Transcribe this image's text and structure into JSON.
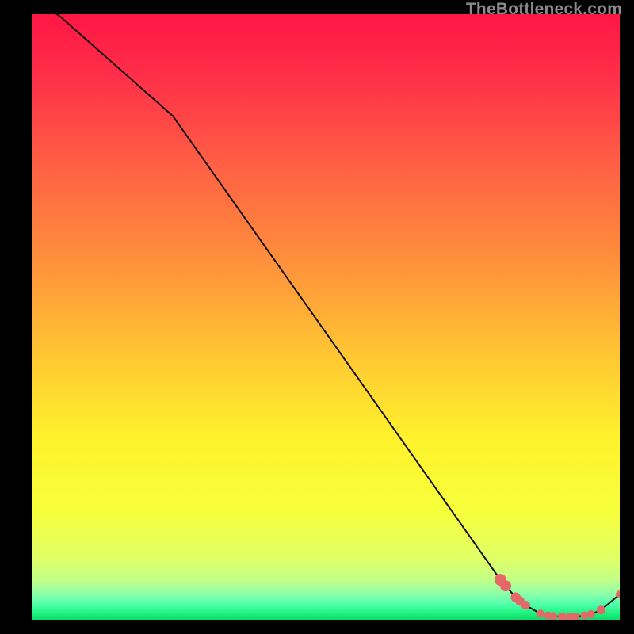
{
  "watermark": "TheBottleneck.com",
  "chart_data": {
    "type": "line",
    "title": "",
    "xlabel": "",
    "ylabel": "",
    "xlim": [
      0,
      100
    ],
    "ylim": [
      0,
      100
    ],
    "series": [
      {
        "name": "curve",
        "x": [
          0,
          5,
          24,
          79.7,
          80.6,
          82.3,
          83.0,
          84.0,
          86.5,
          87.8,
          88.7,
          90.1,
          90.3,
          91.5,
          92.5,
          94.0,
          95.1,
          96.8,
          100
        ],
        "values": [
          103,
          99.5,
          83.2,
          6.6,
          5.6,
          3.7,
          3.1,
          2.4,
          1.0,
          0.7,
          0.6,
          0.5,
          0.5,
          0.5,
          0.5,
          0.7,
          0.9,
          1.6,
          4.2
        ],
        "color": "#111111"
      },
      {
        "name": "markers",
        "x": [
          79.7,
          80.6,
          82.3,
          83.0,
          84.0,
          86.5,
          87.8,
          88.7,
          90.1,
          90.3,
          91.5,
          92.5,
          94.0,
          95.1,
          96.8,
          100
        ],
        "values": [
          6.6,
          5.6,
          3.7,
          3.1,
          2.4,
          1.0,
          0.7,
          0.6,
          0.5,
          0.5,
          0.5,
          0.5,
          0.7,
          0.9,
          1.6,
          4.2
        ],
        "sizes": [
          7.5,
          7.0,
          6.2,
          5.9,
          5.6,
          5.1,
          5.0,
          5.0,
          5.0,
          5.0,
          5.0,
          5.0,
          5.0,
          5.2,
          5.5,
          5.0
        ],
        "color": "#e46868"
      }
    ],
    "gradient_stops": [
      {
        "offset": 0.0,
        "color": "#ff1744"
      },
      {
        "offset": 0.1,
        "color": "#ff2e49"
      },
      {
        "offset": 0.25,
        "color": "#ff6044"
      },
      {
        "offset": 0.4,
        "color": "#ff8d3c"
      },
      {
        "offset": 0.55,
        "color": "#ffc233"
      },
      {
        "offset": 0.7,
        "color": "#fff22c"
      },
      {
        "offset": 0.82,
        "color": "#f7ff3b"
      },
      {
        "offset": 0.9,
        "color": "#dfff66"
      },
      {
        "offset": 0.935,
        "color": "#c1ff8a"
      },
      {
        "offset": 0.958,
        "color": "#8bffab"
      },
      {
        "offset": 0.975,
        "color": "#4effac"
      },
      {
        "offset": 0.99,
        "color": "#1cf27d"
      },
      {
        "offset": 1.0,
        "color": "#0fd96a"
      }
    ]
  }
}
